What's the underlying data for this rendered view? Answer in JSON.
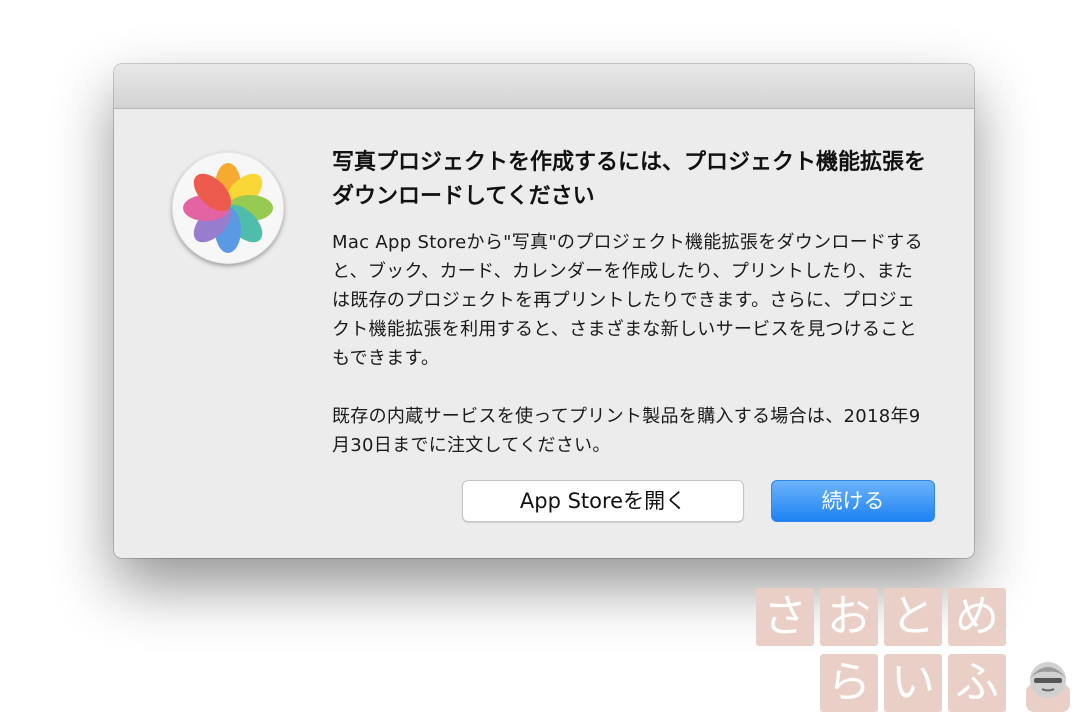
{
  "dialog": {
    "title": "写真プロジェクトを作成するには、プロジェクト機能拡張をダウンロードしてください",
    "paragraph1": "Mac App Storeから\"写真\"のプロジェクト機能拡張をダウンロードすると、ブック、カード、カレンダーを作成したり、プリントしたり、または既存のプロジェクトを再プリントしたりできます。さらに、プロジェクト機能拡張を利用すると、さまざまな新しいサービスを見つけることもできます。",
    "paragraph2": "既存の内蔵サービスを使ってプリント製品を購入する場合は、2018年9月30日までに注文してください。",
    "buttons": {
      "open_app_store": "App Storeを開く",
      "continue": "続ける"
    },
    "icon": "photos-app-icon"
  },
  "watermark": {
    "chars": [
      "さ",
      "お",
      "と",
      "め",
      "ら",
      "い",
      "ふ"
    ]
  },
  "colors": {
    "primary_button": "#1d82f3",
    "dialog_background": "#ececec",
    "watermark": "#e9cfc6"
  }
}
